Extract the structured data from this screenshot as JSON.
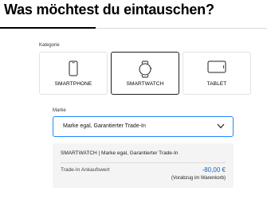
{
  "page": {
    "title": "Was möchtest du eintauschen?"
  },
  "category": {
    "label": "Kategorie",
    "options": [
      {
        "label": "SMARTPHONE",
        "icon": "smartphone-icon",
        "selected": false
      },
      {
        "label": "SMARTWATCH",
        "icon": "smartwatch-icon",
        "selected": true
      },
      {
        "label": "TABLET",
        "icon": "tablet-icon",
        "selected": false
      }
    ]
  },
  "brand": {
    "label": "Marke",
    "value": "Marke egal, Garantierter Trade-In",
    "icon": "chevron-down-icon",
    "accent_color": "#2189ff"
  },
  "summary": {
    "title": "SMARTWATCH | Marke egal, Garantierter Trade-In",
    "trade_in_label": "Trade-In Ankaufswert",
    "trade_in_value": "-80,00 €",
    "note": "(Vorabzug im Warenkorb)",
    "price_color": "#1565c0"
  }
}
